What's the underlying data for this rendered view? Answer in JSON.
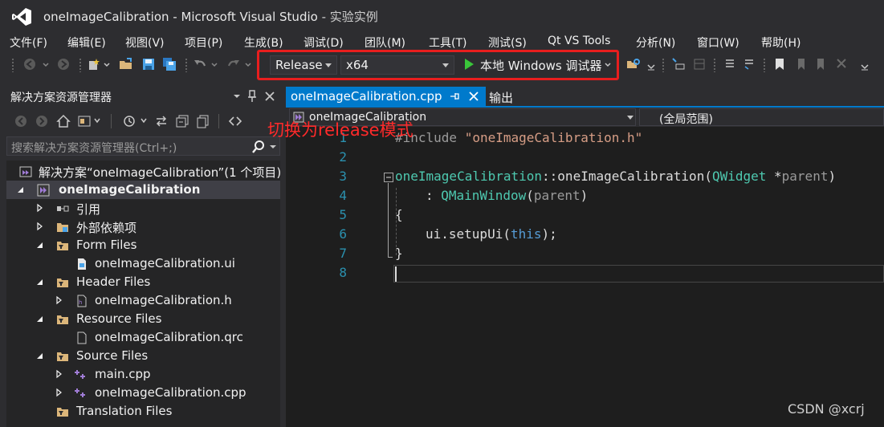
{
  "window": {
    "title": "oneImageCalibration - Microsoft Visual Studio",
    "subtitle": "- 实验实例"
  },
  "menu": [
    "文件(F)",
    "编辑(E)",
    "视图(V)",
    "项目(P)",
    "生成(B)",
    "调试(D)",
    "团队(M)",
    "工具(T)",
    "测试(S)",
    "Qt VS Tools",
    "分析(N)",
    "窗口(W)",
    "帮助(H)"
  ],
  "toolbar": {
    "configuration": "Release",
    "platform": "x64",
    "debugger_label": "本地 Windows 调试器"
  },
  "annotation": "切换为release模式",
  "solution_explorer": {
    "title": "解决方案资源管理器",
    "search_placeholder": "搜索解决方案资源管理器(Ctrl+;)",
    "solution": "解决方案“oneImageCalibration”(1 个项目)",
    "project": "oneImageCalibration",
    "references": "引用",
    "external_deps": "外部依赖项",
    "form_files": "Form Files",
    "form_file_1": "oneImageCalibration.ui",
    "header_files": "Header Files",
    "header_file_1": "oneImageCalibration.h",
    "resource_files": "Resource Files",
    "resource_file_1": "oneImageCalibration.qrc",
    "source_files": "Source Files",
    "source_file_1": "main.cpp",
    "source_file_2": "oneImageCalibration.cpp",
    "translation_files": "Translation Files"
  },
  "editor": {
    "active_tab": "oneImageCalibration.cpp",
    "other_tab": "输出",
    "nav_scope": "oneImageCalibration",
    "nav_member": "(全局范围)",
    "line_numbers": [
      "1",
      "2",
      "3",
      "4",
      "5",
      "6",
      "7",
      "8"
    ]
  },
  "code": {
    "l1_directive": "#include",
    "l1_file": "\"oneImageCalibration.h\"",
    "l3_class": "oneImageCalibration",
    "l3_sep": "::",
    "l3_ctor": "oneImageCalibration(",
    "l3_type": "QWidget",
    "l3_ptr": " *",
    "l3_param": "parent",
    "l3_close": ")",
    "l4_colon": ": ",
    "l4_base": "QMainWindow",
    "l4_open": "(",
    "l4_param": "parent",
    "l4_close": ")",
    "l5": "{",
    "l6_obj": "ui.setupUi(",
    "l6_this": "this",
    "l6_end": ");",
    "l7": "}"
  },
  "watermark": "CSDN @xcrj",
  "colors": {
    "accent": "#007acc",
    "highlight": "#e81e1e",
    "run_green": "#3ac63a"
  }
}
